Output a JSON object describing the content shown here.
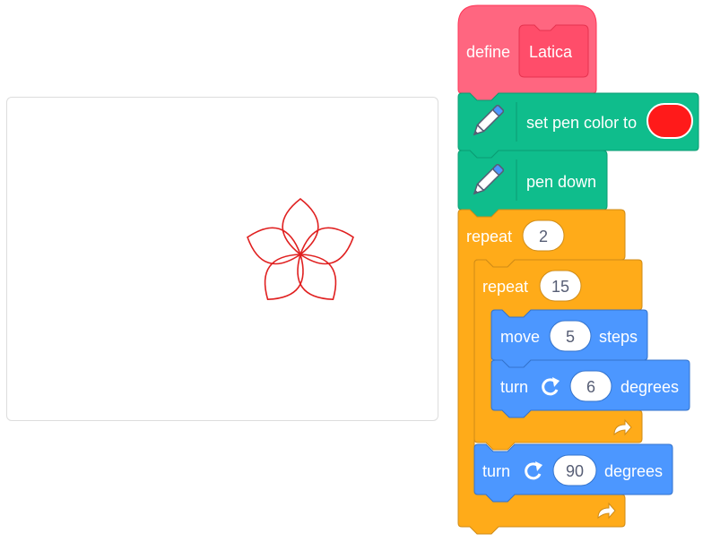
{
  "script": {
    "define_label": "define",
    "procedure_name": "Latica",
    "set_pen_color_label": "set pen color to",
    "pen_color": "#ff1a1a",
    "pen_down_label": "pen down",
    "outer_repeat": {
      "label": "repeat",
      "count": "2"
    },
    "inner_repeat": {
      "label": "repeat",
      "count": "15"
    },
    "move": {
      "label": "move",
      "steps": "5",
      "suffix": "steps"
    },
    "turn_inner": {
      "label": "turn",
      "degrees": "6",
      "suffix": "degrees"
    },
    "turn_outer": {
      "label": "turn",
      "degrees": "90",
      "suffix": "degrees"
    }
  },
  "colors": {
    "events_pink": "#ff6680",
    "events_pink_dark": "#ff4d6a",
    "pen_green": "#0fbd8c",
    "control_orange": "#ffab19",
    "motion_blue": "#4c97ff",
    "drawing_red": "#e02020"
  },
  "icons": {
    "pen_extension": "pen-icon",
    "turn_clockwise": "rotate-right-icon",
    "loop_arrow": "loop-arrow-icon"
  }
}
